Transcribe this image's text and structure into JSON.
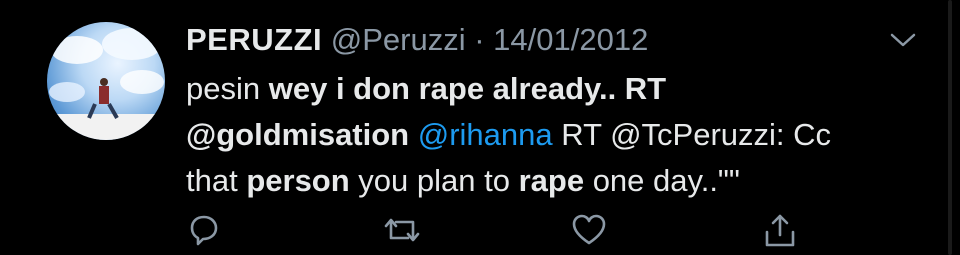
{
  "tweet": {
    "display_name": "PERUZZI",
    "handle": "@Peruzzi",
    "separator": "·",
    "date": "14/01/2012",
    "body": {
      "l1_a": "pesin ",
      "l1_b": "wey i don rape already.. RT",
      "l2_a": "@goldmisation",
      "l2_b": " ",
      "l2_c": "@rihanna",
      "l2_d": " RT @TcPeruzzi: Cc",
      "l3_a": "that ",
      "l3_b": "person",
      "l3_c": " you plan to ",
      "l3_d": "rape",
      "l3_e": " one day..\"\""
    }
  },
  "icons": {
    "more": "chevron-down-icon",
    "reply": "reply-icon",
    "retweet": "retweet-icon",
    "like": "heart-icon",
    "share": "share-icon"
  },
  "colors": {
    "background": "#000000",
    "text": "#e7e9ea",
    "secondary": "#8b98a5",
    "link": "#1d9bf0"
  }
}
